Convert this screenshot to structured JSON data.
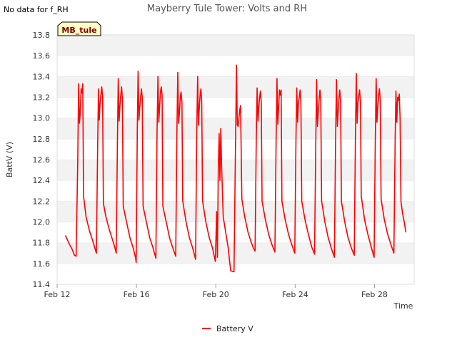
{
  "page": {
    "title": "Mayberry Tule Tower: Volts and RH",
    "corner_note": "No data for f_RH",
    "site_tag": "MB_tule"
  },
  "chart_data": {
    "type": "line",
    "title": "Mayberry Tule Tower: Volts and RH",
    "xlabel": "Time",
    "ylabel": "BattV (V)",
    "xlim": [
      "2023-02-12",
      "2023-03-02"
    ],
    "ylim": [
      11.4,
      13.8
    ],
    "x_ticks": [
      "Feb 12",
      "Feb 16",
      "Feb 20",
      "Feb 24",
      "Feb 28"
    ],
    "x_tick_dates": [
      "2023-02-12",
      "2023-02-16",
      "2023-02-20",
      "2023-02-24",
      "2023-02-28"
    ],
    "y_ticks": [
      11.4,
      11.6,
      11.8,
      12.0,
      12.2,
      12.4,
      12.6,
      12.8,
      13.0,
      13.2,
      13.4,
      13.6,
      13.8
    ],
    "grid": "horizontal bands",
    "legend_position": "bottom-center",
    "series": [
      {
        "name": "Battery V",
        "color": "#ff0000",
        "points": [
          [
            "2023-02-12T10:00",
            11.87
          ],
          [
            "2023-02-12T14:00",
            11.8
          ],
          [
            "2023-02-12T18:00",
            11.74
          ],
          [
            "2023-02-12T21:00",
            11.68
          ],
          [
            "2023-02-12T23:00",
            11.67
          ],
          [
            "2023-02-13T01:00",
            12.6
          ],
          [
            "2023-02-13T02:00",
            13.33
          ],
          [
            "2023-02-13T03:00",
            12.95
          ],
          [
            "2023-02-13T04:00",
            13.05
          ],
          [
            "2023-02-13T05:00",
            13.28
          ],
          [
            "2023-02-13T06:00",
            13.24
          ],
          [
            "2023-02-13T07:00",
            13.33
          ],
          [
            "2023-02-13T08:00",
            12.25
          ],
          [
            "2023-02-13T11:00",
            12.05
          ],
          [
            "2023-02-13T15:00",
            11.92
          ],
          [
            "2023-02-13T19:00",
            11.82
          ],
          [
            "2023-02-13T22:00",
            11.74
          ],
          [
            "2023-02-13T23:30",
            11.7
          ],
          [
            "2023-02-14T01:00",
            12.7
          ],
          [
            "2023-02-14T02:00",
            13.28
          ],
          [
            "2023-02-14T03:00",
            12.98
          ],
          [
            "2023-02-14T04:00",
            13.15
          ],
          [
            "2023-02-14T05:00",
            13.22
          ],
          [
            "2023-02-14T06:00",
            13.3
          ],
          [
            "2023-02-14T07:00",
            13.2
          ],
          [
            "2023-02-14T08:00",
            12.18
          ],
          [
            "2023-02-14T11:00",
            12.05
          ],
          [
            "2023-02-14T15:00",
            11.93
          ],
          [
            "2023-02-14T19:00",
            11.83
          ],
          [
            "2023-02-14T22:00",
            11.75
          ],
          [
            "2023-02-14T23:30",
            11.7
          ],
          [
            "2023-02-15T01:00",
            12.8
          ],
          [
            "2023-02-15T02:00",
            13.38
          ],
          [
            "2023-02-15T03:00",
            12.97
          ],
          [
            "2023-02-15T04:00",
            13.12
          ],
          [
            "2023-02-15T05:00",
            13.22
          ],
          [
            "2023-02-15T06:00",
            13.3
          ],
          [
            "2023-02-15T07:00",
            13.18
          ],
          [
            "2023-02-15T08:00",
            12.15
          ],
          [
            "2023-02-15T12:00",
            12.0
          ],
          [
            "2023-02-15T16:00",
            11.85
          ],
          [
            "2023-02-15T20:00",
            11.75
          ],
          [
            "2023-02-15T23:00",
            11.65
          ],
          [
            "2023-02-15T23:40",
            11.61
          ],
          [
            "2023-02-16T01:00",
            12.9
          ],
          [
            "2023-02-16T02:00",
            13.45
          ],
          [
            "2023-02-16T03:00",
            12.98
          ],
          [
            "2023-02-16T04:00",
            13.1
          ],
          [
            "2023-02-16T05:00",
            13.2
          ],
          [
            "2023-02-16T06:00",
            13.28
          ],
          [
            "2023-02-16T07:00",
            13.2
          ],
          [
            "2023-02-16T08:00",
            12.15
          ],
          [
            "2023-02-16T12:00",
            12.0
          ],
          [
            "2023-02-16T16:00",
            11.85
          ],
          [
            "2023-02-16T20:00",
            11.75
          ],
          [
            "2023-02-16T23:30",
            11.65
          ],
          [
            "2023-02-17T01:00",
            12.9
          ],
          [
            "2023-02-17T02:00",
            13.4
          ],
          [
            "2023-02-17T03:00",
            12.96
          ],
          [
            "2023-02-17T04:00",
            13.1
          ],
          [
            "2023-02-17T05:00",
            13.25
          ],
          [
            "2023-02-17T06:00",
            13.3
          ],
          [
            "2023-02-17T07:00",
            13.22
          ],
          [
            "2023-02-17T08:00",
            12.15
          ],
          [
            "2023-02-17T12:00",
            12.0
          ],
          [
            "2023-02-17T16:00",
            11.85
          ],
          [
            "2023-02-17T20:00",
            11.75
          ],
          [
            "2023-02-17T23:30",
            11.67
          ],
          [
            "2023-02-18T01:00",
            12.9
          ],
          [
            "2023-02-18T02:00",
            13.44
          ],
          [
            "2023-02-18T03:00",
            12.95
          ],
          [
            "2023-02-18T04:00",
            13.05
          ],
          [
            "2023-02-18T05:00",
            13.2
          ],
          [
            "2023-02-18T06:00",
            13.25
          ],
          [
            "2023-02-18T07:00",
            13.15
          ],
          [
            "2023-02-18T08:00",
            12.2
          ],
          [
            "2023-02-18T12:00",
            12.0
          ],
          [
            "2023-02-18T16:00",
            11.85
          ],
          [
            "2023-02-18T20:00",
            11.75
          ],
          [
            "2023-02-18T23:30",
            11.64
          ],
          [
            "2023-02-19T01:00",
            12.9
          ],
          [
            "2023-02-19T02:00",
            13.4
          ],
          [
            "2023-02-19T03:00",
            12.93
          ],
          [
            "2023-02-19T04:00",
            13.1
          ],
          [
            "2023-02-19T05:00",
            13.22
          ],
          [
            "2023-02-19T06:00",
            13.28
          ],
          [
            "2023-02-19T07:00",
            13.15
          ],
          [
            "2023-02-19T08:00",
            12.2
          ],
          [
            "2023-02-19T12:00",
            12.0
          ],
          [
            "2023-02-19T16:00",
            11.85
          ],
          [
            "2023-02-19T20:00",
            11.75
          ],
          [
            "2023-02-19T23:30",
            11.62
          ],
          [
            "2023-02-20T01:00",
            12.1
          ],
          [
            "2023-02-20T02:00",
            11.66
          ],
          [
            "2023-02-20T03:00",
            12.5
          ],
          [
            "2023-02-20T04:00",
            12.85
          ],
          [
            "2023-02-20T05:00",
            12.4
          ],
          [
            "2023-02-20T06:00",
            12.9
          ],
          [
            "2023-02-20T07:00",
            12.55
          ],
          [
            "2023-02-20T09:00",
            12.05
          ],
          [
            "2023-02-20T12:00",
            11.9
          ],
          [
            "2023-02-20T15:00",
            11.75
          ],
          [
            "2023-02-20T17:00",
            11.6
          ],
          [
            "2023-02-20T18:00",
            11.53
          ],
          [
            "2023-02-20T22:00",
            11.52
          ],
          [
            "2023-02-21T00:00",
            12.85
          ],
          [
            "2023-02-21T01:00",
            13.51
          ],
          [
            "2023-02-21T02:00",
            12.93
          ],
          [
            "2023-02-21T03:00",
            12.92
          ],
          [
            "2023-02-21T04:00",
            13.0
          ],
          [
            "2023-02-21T05:00",
            13.08
          ],
          [
            "2023-02-21T06:00",
            13.12
          ],
          [
            "2023-02-21T07:30",
            12.22
          ],
          [
            "2023-02-21T11:00",
            12.05
          ],
          [
            "2023-02-21T15:00",
            11.9
          ],
          [
            "2023-02-21T19:00",
            11.8
          ],
          [
            "2023-02-21T22:00",
            11.74
          ],
          [
            "2023-02-21T23:30",
            11.72
          ],
          [
            "2023-02-22T01:00",
            12.8
          ],
          [
            "2023-02-22T02:00",
            13.29
          ],
          [
            "2023-02-22T03:00",
            12.97
          ],
          [
            "2023-02-22T04:00",
            13.1
          ],
          [
            "2023-02-22T05:00",
            13.2
          ],
          [
            "2023-02-22T06:00",
            13.26
          ],
          [
            "2023-02-22T07:00",
            13.15
          ],
          [
            "2023-02-22T08:00",
            12.2
          ],
          [
            "2023-02-22T12:00",
            12.02
          ],
          [
            "2023-02-22T16:00",
            11.88
          ],
          [
            "2023-02-22T20:00",
            11.78
          ],
          [
            "2023-02-22T23:30",
            11.71
          ],
          [
            "2023-02-23T01:00",
            12.8
          ],
          [
            "2023-02-23T02:00",
            13.38
          ],
          [
            "2023-02-23T03:00",
            12.94
          ],
          [
            "2023-02-23T04:00",
            13.1
          ],
          [
            "2023-02-23T05:00",
            13.27
          ],
          [
            "2023-02-23T06:00",
            13.22
          ],
          [
            "2023-02-23T07:00",
            13.27
          ],
          [
            "2023-02-23T08:00",
            12.2
          ],
          [
            "2023-02-23T12:00",
            12.02
          ],
          [
            "2023-02-23T16:00",
            11.88
          ],
          [
            "2023-02-23T20:00",
            11.78
          ],
          [
            "2023-02-23T23:30",
            11.7
          ],
          [
            "2023-02-24T01:00",
            12.8
          ],
          [
            "2023-02-24T02:00",
            13.29
          ],
          [
            "2023-02-24T03:00",
            12.96
          ],
          [
            "2023-02-24T04:00",
            13.15
          ],
          [
            "2023-02-24T05:00",
            13.2
          ],
          [
            "2023-02-24T06:00",
            13.27
          ],
          [
            "2023-02-24T07:00",
            13.15
          ],
          [
            "2023-02-24T08:00",
            12.2
          ],
          [
            "2023-02-24T12:00",
            12.02
          ],
          [
            "2023-02-24T16:00",
            11.88
          ],
          [
            "2023-02-24T20:00",
            11.76
          ],
          [
            "2023-02-24T23:30",
            11.69
          ],
          [
            "2023-02-25T01:00",
            12.8
          ],
          [
            "2023-02-25T02:00",
            13.37
          ],
          [
            "2023-02-25T03:00",
            12.92
          ],
          [
            "2023-02-25T04:00",
            13.05
          ],
          [
            "2023-02-25T05:00",
            13.18
          ],
          [
            "2023-02-25T06:00",
            13.27
          ],
          [
            "2023-02-25T07:00",
            13.17
          ],
          [
            "2023-02-25T08:00",
            12.2
          ],
          [
            "2023-02-25T12:00",
            12.0
          ],
          [
            "2023-02-25T16:00",
            11.85
          ],
          [
            "2023-02-25T20:00",
            11.74
          ],
          [
            "2023-02-25T23:30",
            11.66
          ],
          [
            "2023-02-26T01:00",
            12.8
          ],
          [
            "2023-02-26T02:00",
            13.37
          ],
          [
            "2023-02-26T03:00",
            12.92
          ],
          [
            "2023-02-26T04:00",
            13.05
          ],
          [
            "2023-02-26T05:00",
            13.2
          ],
          [
            "2023-02-26T06:00",
            13.27
          ],
          [
            "2023-02-26T07:00",
            13.15
          ],
          [
            "2023-02-26T08:00",
            12.2
          ],
          [
            "2023-02-26T12:00",
            12.0
          ],
          [
            "2023-02-26T16:00",
            11.85
          ],
          [
            "2023-02-26T20:00",
            11.75
          ],
          [
            "2023-02-26T23:30",
            11.68
          ],
          [
            "2023-02-27T01:00",
            12.85
          ],
          [
            "2023-02-27T02:00",
            13.43
          ],
          [
            "2023-02-27T03:00",
            12.95
          ],
          [
            "2023-02-27T04:00",
            13.15
          ],
          [
            "2023-02-27T05:00",
            13.22
          ],
          [
            "2023-02-27T06:00",
            13.27
          ],
          [
            "2023-02-27T07:00",
            13.15
          ],
          [
            "2023-02-27T08:00",
            12.25
          ],
          [
            "2023-02-27T12:00",
            12.02
          ],
          [
            "2023-02-27T16:00",
            11.88
          ],
          [
            "2023-02-27T20:00",
            11.76
          ],
          [
            "2023-02-27T23:30",
            11.66
          ],
          [
            "2023-02-28T01:00",
            12.8
          ],
          [
            "2023-02-28T02:00",
            13.38
          ],
          [
            "2023-02-28T03:00",
            12.96
          ],
          [
            "2023-02-28T04:00",
            13.1
          ],
          [
            "2023-02-28T05:00",
            13.22
          ],
          [
            "2023-02-28T06:00",
            13.28
          ],
          [
            "2023-02-28T07:00",
            13.17
          ],
          [
            "2023-02-28T08:00",
            12.22
          ],
          [
            "2023-02-28T12:00",
            12.02
          ],
          [
            "2023-02-28T16:00",
            11.88
          ],
          [
            "2023-02-28T20:00",
            11.78
          ],
          [
            "2023-02-28T23:30",
            11.7
          ],
          [
            "2023-03-01T01:00",
            12.8
          ],
          [
            "2023-03-01T02:00",
            13.26
          ],
          [
            "2023-03-01T03:00",
            12.96
          ],
          [
            "2023-03-01T04:00",
            13.2
          ],
          [
            "2023-03-01T05:00",
            13.17
          ],
          [
            "2023-03-01T06:00",
            13.23
          ],
          [
            "2023-03-01T07:00",
            13.0
          ],
          [
            "2023-03-01T08:00",
            12.2
          ],
          [
            "2023-03-01T10:00",
            12.08
          ],
          [
            "2023-03-01T12:00",
            12.0
          ],
          [
            "2023-03-01T14:00",
            11.9
          ]
        ]
      }
    ]
  }
}
